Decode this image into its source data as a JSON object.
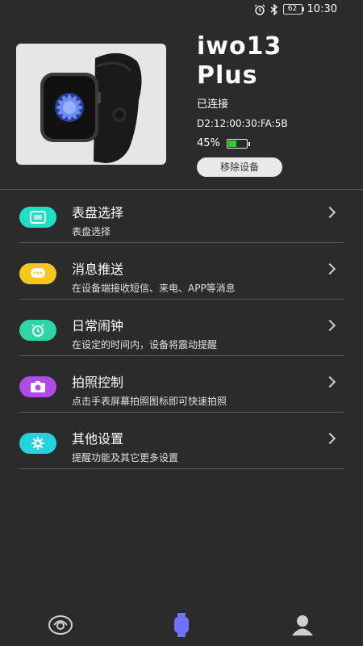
{
  "status_bar": {
    "battery": "62",
    "time": "10:30"
  },
  "device": {
    "name_line1": "iwo13",
    "name_line2": "Plus",
    "status": "已连接",
    "mac": "D2:12:00:30:FA:5B",
    "battery_percent": "45%",
    "battery_level": 0.45,
    "remove_label": "移除设备"
  },
  "menu": [
    {
      "title": "表盘选择",
      "subtitle": "表盘选择",
      "icon": "watch-face-icon",
      "color": "#1ee0c4"
    },
    {
      "title": "消息推送",
      "subtitle": "在设备端接收短信、来电、APP等消息",
      "icon": "message-icon",
      "color": "#f7c61e"
    },
    {
      "title": "日常闹钟",
      "subtitle": "在设定的时间内，设备将震动提醒",
      "icon": "alarm-icon",
      "color": "#2ed6a6"
    },
    {
      "title": "拍照控制",
      "subtitle": "点击手表屏幕拍照图标即可快速拍照",
      "icon": "camera-icon",
      "color": "#b04be8"
    },
    {
      "title": "其他设置",
      "subtitle": "提醒功能及其它更多设置",
      "icon": "gear-icon",
      "color": "#22d3df"
    }
  ],
  "bottom_nav": [
    {
      "icon": "activity-icon"
    },
    {
      "icon": "watch-icon",
      "active_color": "#6f73ff"
    },
    {
      "icon": "profile-icon"
    }
  ]
}
